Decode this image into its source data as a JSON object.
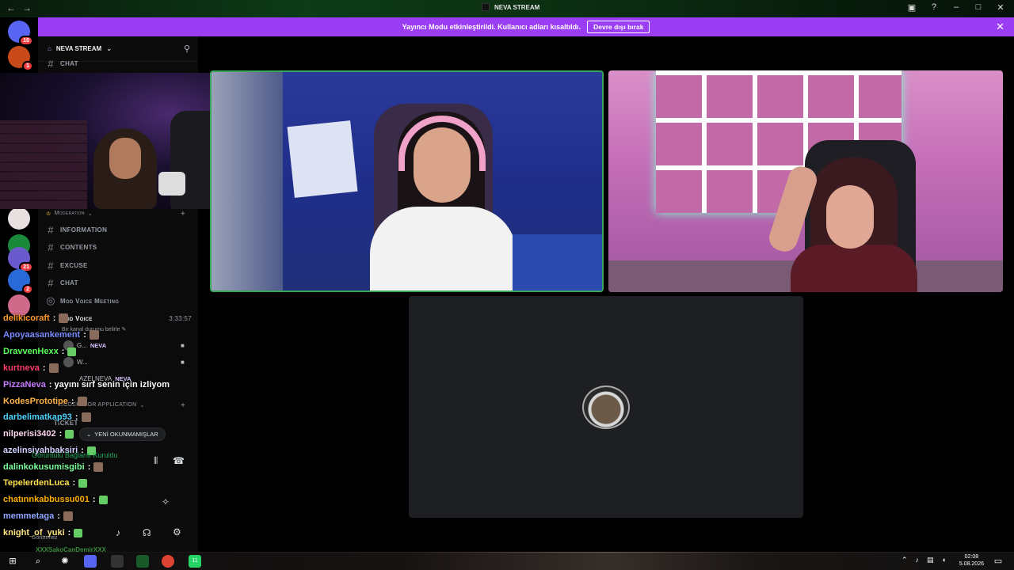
{
  "window": {
    "title": "NEVA STREAM",
    "nav_back": "←",
    "nav_fwd": "→"
  },
  "banner": {
    "text": "Yayıncı Modu etkinleştirildi. Kullanıcı adları kısaltıldı.",
    "button": "Devre dışı bırak"
  },
  "rail": {
    "dm_badge": "10",
    "server1_badge": "1",
    "server_badges": [
      "21",
      "2"
    ]
  },
  "server": {
    "name": "NEVA STREAM",
    "categories": {
      "moderation": "Moderation",
      "mod_application": "MODERATOR APPLICATION"
    },
    "top_channel": "CHAT",
    "channels": [
      "INFORMATION",
      "CONTENTS",
      "EXCUSE",
      "CHAT"
    ],
    "voice_meeting": "Mod Voice Meeting",
    "voice_channel": "Mod Voice",
    "voice_timer": "3:33:57",
    "voice_status_prompt": "Bir kanal durumu belirle",
    "voice_users": [
      {
        "name": "G...",
        "tag": "NEVA"
      },
      {
        "name": "W...",
        "tag": ""
      }
    ],
    "aleln_user": "AZELNEVA",
    "aleln_tag": "NEVA",
    "ticket_channel": "TICKET"
  },
  "unread_pill": "YENİ OKUNMAMIŞLAR",
  "voice_connection": "Görüntülü Bağlantı Kuruldu",
  "current_user_status": "Görünmez",
  "chat": [
    {
      "user": "delikicoraft",
      "color": "#ff9a2e",
      "msg": ":"
    },
    {
      "user": "Apoyaasankement",
      "color": "#7a8cff",
      "msg": ":"
    },
    {
      "user": "DravvenHexx",
      "color": "#5cff5c",
      "msg": ":"
    },
    {
      "user": "kurtneva",
      "color": "#ff3b6b",
      "msg": ":"
    },
    {
      "user": "PizzaNeva",
      "color": "#c77dff",
      "msg": ": yayını sırf senin için izliyom"
    },
    {
      "user": "KodesPrototipe",
      "color": "#ffb347",
      "msg": ":"
    },
    {
      "user": "darbelimatkap93",
      "color": "#4fd6ff",
      "msg": ":"
    },
    {
      "user": "nilperisi3402",
      "color": "#ffd6f0",
      "msg": ":"
    },
    {
      "user": "azelinsiyahbaksiri",
      "color": "#d0d0ff",
      "msg": ":"
    },
    {
      "user": "dalinkokusumisgibi",
      "color": "#7dff9a",
      "msg": ":"
    },
    {
      "user": "TepelerdenLuca",
      "color": "#ffe34d",
      "msg": ":"
    },
    {
      "user": "chatınnkabbussu001",
      "color": "#ffb000",
      "msg": ":"
    },
    {
      "user": "memmetaga",
      "color": "#8fa8ff",
      "msg": ":"
    },
    {
      "user": "knight_of_yuki",
      "color": "#ffe680",
      "msg": ":"
    }
  ],
  "chat_bottom_user": "XXXSakoCanDemirXXX",
  "taskbar": {
    "time": "02:08",
    "date": "5.08.2026",
    "whatsapp_badge": "11"
  },
  "colors": {
    "banner": "#9b3df2",
    "speaking_border": "#3ba55c",
    "badge": "#f23f43"
  }
}
